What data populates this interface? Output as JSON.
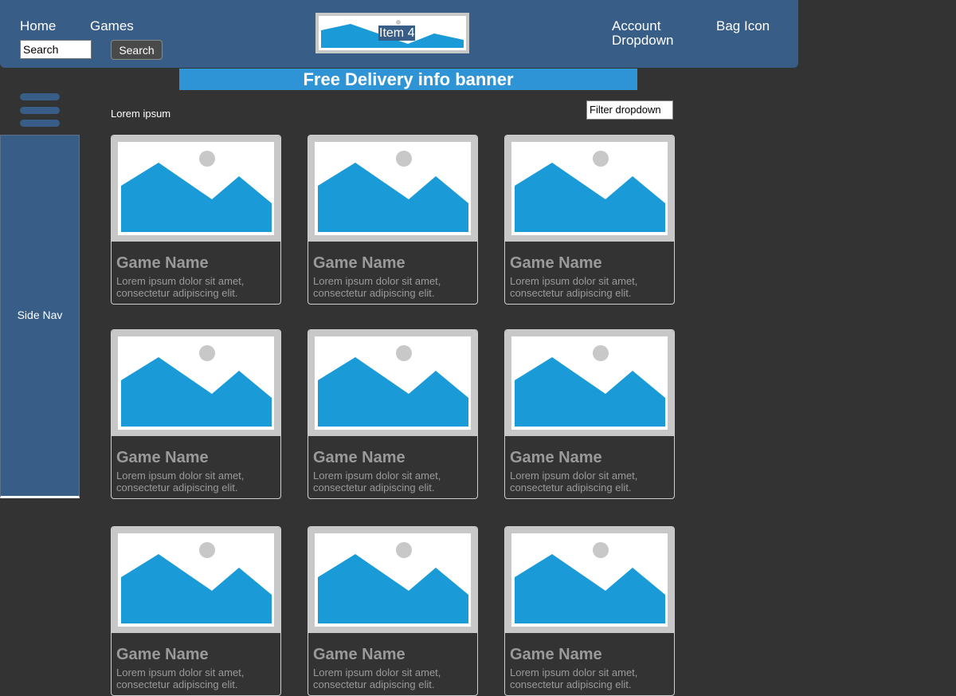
{
  "header": {
    "nav": [
      {
        "label": "Home"
      },
      {
        "label": "Games"
      }
    ],
    "search": {
      "value": "Search",
      "button_label": "Search"
    },
    "logo": {
      "label": "Item 4"
    },
    "account_label": "Account Dropdown",
    "bag_label": "Bag Icon"
  },
  "banner": {
    "text": "Free Delivery info banner"
  },
  "side_nav": {
    "label": "Side Nav",
    "menu_icon": "hamburger-icon"
  },
  "content": {
    "section_label": "Lorem ipsum",
    "filter_label": "Filter dropdown",
    "cards": [
      {
        "title": "Game Name",
        "description": "Lorem ipsum dolor sit amet, consectetur adipiscing elit."
      },
      {
        "title": "Game Name",
        "description": "Lorem ipsum dolor sit amet, consectetur adipiscing elit."
      },
      {
        "title": "Game Name",
        "description": "Lorem ipsum dolor sit amet, consectetur adipiscing elit."
      },
      {
        "title": "Game Name",
        "description": "Lorem ipsum dolor sit amet, consectetur adipiscing elit."
      },
      {
        "title": "Game Name",
        "description": "Lorem ipsum dolor sit amet, consectetur adipiscing elit."
      },
      {
        "title": "Game Name",
        "description": "Lorem ipsum dolor sit amet, consectetur adipiscing elit."
      },
      {
        "title": "Game Name",
        "description": "Lorem ipsum dolor sit amet, consectetur adipiscing elit."
      },
      {
        "title": "Game Name",
        "description": "Lorem ipsum dolor sit amet, consectetur adipiscing elit."
      },
      {
        "title": "Game Name",
        "description": "Lorem ipsum dolor sit amet, consectetur adipiscing elit."
      }
    ]
  },
  "colors": {
    "background": "#333333",
    "header": "#385d87",
    "banner": "#2f94d6",
    "image_placeholder": "#1a9bd7",
    "card_text": "#9a9a9a"
  }
}
